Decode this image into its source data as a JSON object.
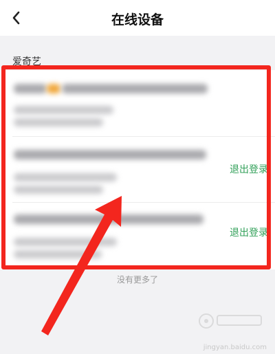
{
  "header": {
    "title": "在线设备",
    "back_icon": "back-arrow-icon"
  },
  "section": {
    "label": "爱奇艺"
  },
  "devices": [
    {
      "logout_label": ""
    },
    {
      "logout_label": "退出登录"
    },
    {
      "logout_label": "退出登录"
    }
  ],
  "footer": {
    "note": "没有更多了"
  },
  "watermark": {
    "logo": "baidu-jingyan-logo",
    "url_text": "jingyan.baidu.com"
  },
  "colors": {
    "logout": "#2f9f57",
    "highlight": "#f3261e",
    "arrow": "#f3261e"
  }
}
